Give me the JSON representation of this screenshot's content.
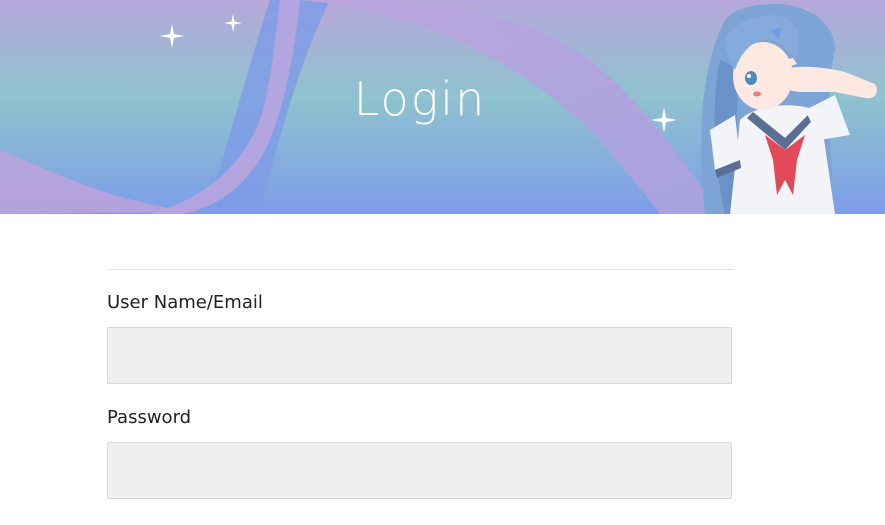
{
  "banner": {
    "title": "Login",
    "illustration_icon": "anime-girl-illustration",
    "colors": {
      "gradient_top": "#b3a9d8",
      "gradient_mid": "#8fc3d0",
      "gradient_bottom": "#7a9fe6",
      "ribbon_lavender": "#b6a6dc",
      "ribbon_blue": "#7e9be6"
    }
  },
  "form": {
    "username_label": "User Name/Email",
    "username_value": "",
    "password_label": "Password",
    "password_value": "",
    "input_background": "#efefef"
  }
}
